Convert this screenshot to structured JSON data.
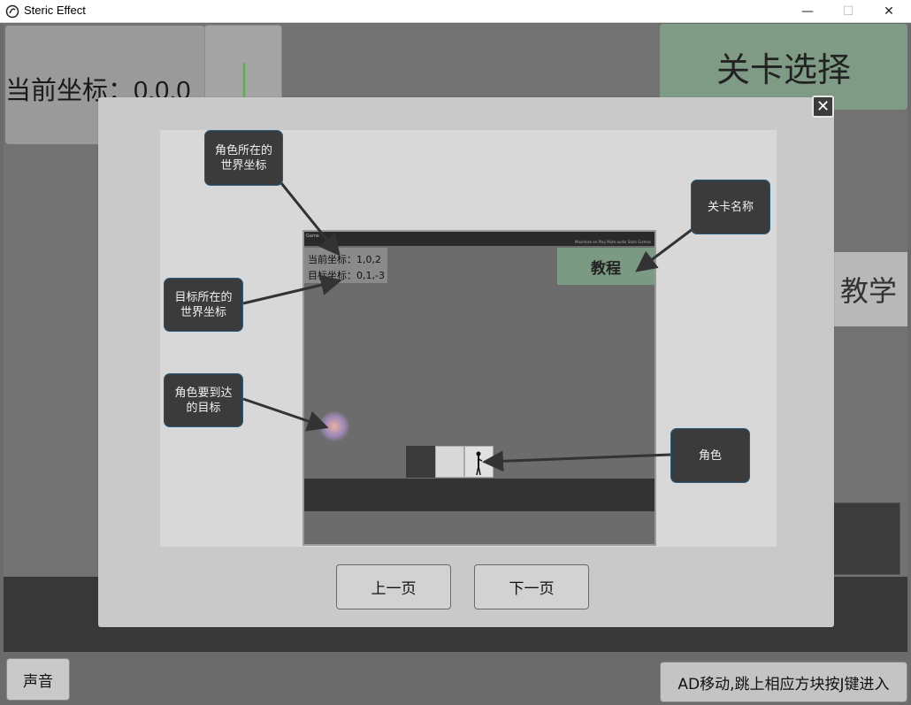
{
  "window": {
    "title": "Steric Effect",
    "minimize": "—",
    "maximize": "☐",
    "close": "✕"
  },
  "hud": {
    "current_coord_label": "当前坐标：0,0,0",
    "level_select_label": "关卡选择",
    "tutorial_tab_label": "教学",
    "sound_label": "声音",
    "hint_text": "AD移动,跳上相应方块按J键进入"
  },
  "modal": {
    "close_symbol": "✕",
    "prev_label": "上一页",
    "next_label": "下一页",
    "screenshot": {
      "current_coord": "当前坐标：1,0,2",
      "target_coord": "目标坐标：0,1,-3",
      "level_name": "教程",
      "tab_label": "Game",
      "status_text": "Maximize on Play  Mute audio  Stats  Gizmos"
    },
    "callouts": {
      "char_coord": "角色所在的\n世界坐标",
      "target_coord": "目标所在的\n世界坐标",
      "target": "角色要到达\n的目标",
      "level_name": "关卡名称",
      "character": "角色"
    }
  },
  "colors": {
    "level_select_bg": "#7f9b86",
    "callout_bg": "#3b3b3b",
    "modal_bg": "#c9c9c9"
  }
}
